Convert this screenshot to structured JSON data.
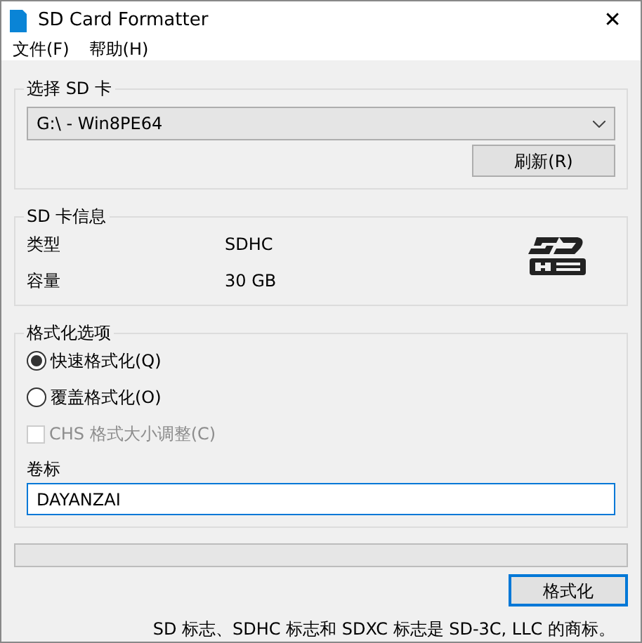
{
  "window": {
    "title": "SD Card Formatter",
    "close": "✕"
  },
  "menu": [
    "文件(F)",
    "帮助(H)"
  ],
  "select_card": {
    "title": "选择 SD 卡",
    "drive": "G:\\ - Win8PE64",
    "refresh_button": "刷新(R)"
  },
  "card_info": {
    "title": "SD 卡信息",
    "rows": [
      {
        "label": "类型",
        "value": "SDHC"
      },
      {
        "label": "容量",
        "value": "30 GB"
      }
    ]
  },
  "format_options": {
    "title": "格式化选项",
    "options": [
      {
        "kind": "radio",
        "label": "快速格式化(Q)",
        "selected": true,
        "disabled": false
      },
      {
        "kind": "radio",
        "label": "覆盖格式化(O)",
        "selected": false,
        "disabled": false
      },
      {
        "kind": "checkbox",
        "label": "CHS 格式大小调整(C)",
        "checked": false,
        "disabled": true
      }
    ],
    "volume_label": {
      "label": "卷标",
      "value": "DAYANZAI"
    }
  },
  "format_button": "格式化",
  "footer": "SD 标志、SDHC 标志和 SDXC 标志是 SD-3C, LLC 的商标。"
}
